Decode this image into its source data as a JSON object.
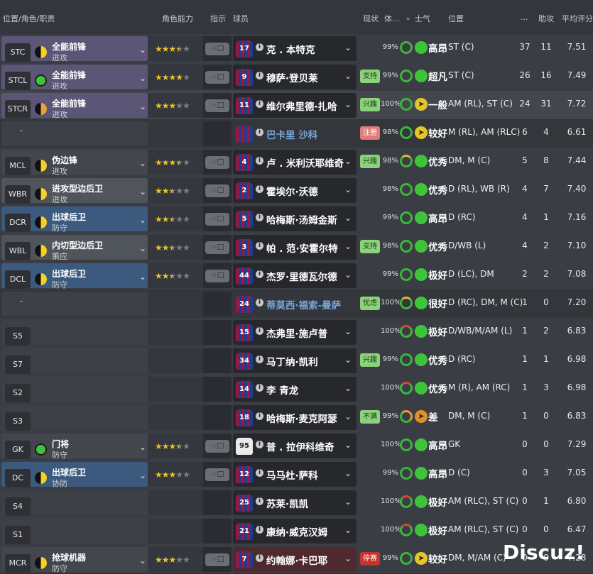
{
  "header": {
    "col_position": "位置/角色/职责",
    "col_ability": "角色能力",
    "col_instruction": "指示",
    "col_player": "球员",
    "col_status": "现状",
    "col_condition": "体...",
    "col_morale": "士气",
    "col_positions": "位置",
    "col_apps": "...",
    "col_assists": "助攻",
    "col_avg_rating": "平均评分"
  },
  "rows": [
    {
      "pos": "STC",
      "role": "全能前锋",
      "duty": "进攻",
      "stars": 3.5,
      "number": "17",
      "name": "克 . 本特克",
      "status": "",
      "cond": "99%",
      "morale": "高昂",
      "positions": "ST (C)",
      "apps": "37",
      "assists": "11",
      "rating": "7.51"
    },
    {
      "pos": "STCL",
      "role": "全能前锋",
      "duty": "进攻",
      "stars": 4,
      "number": "9",
      "name": "穆萨·登贝莱",
      "status": "支持",
      "cond": "99%",
      "morale": "超凡",
      "positions": "ST (C)",
      "apps": "26",
      "assists": "16",
      "rating": "7.49"
    },
    {
      "pos": "STCR",
      "role": "全能前锋",
      "duty": "进攻",
      "stars": 3,
      "number": "11",
      "name": "维尔弗里德·扎哈",
      "status": "兴趣",
      "cond": "100%",
      "morale": "一般",
      "positions": "AM (RL), ST (C)",
      "apps": "24",
      "assists": "31",
      "rating": "7.72"
    },
    {
      "pos": "-",
      "role": "",
      "duty": "",
      "stars": 0,
      "number": "",
      "name": "巴卡里 沙科",
      "status": "注册",
      "cond": "98%",
      "morale": "较好",
      "positions": "M (RL), AM (RLC)",
      "apps": "6",
      "assists": "4",
      "rating": "6.61"
    },
    {
      "pos": "MCL",
      "role": "伪边锋",
      "duty": "进攻",
      "stars": 3.5,
      "number": "4",
      "name": "卢 . 米利沃耶维奇",
      "status": "兴趣",
      "cond": "98%",
      "morale": "优秀",
      "positions": "DM, M (C)",
      "apps": "5",
      "assists": "8",
      "rating": "7.44"
    },
    {
      "pos": "WBR",
      "role": "进攻型边后卫",
      "duty": "进攻",
      "stars": 2.5,
      "number": "2",
      "name": "霍埃尔·沃德",
      "status": "",
      "cond": "98%",
      "morale": "优秀",
      "positions": "D (RL), WB (R)",
      "apps": "4",
      "assists": "7",
      "rating": "7.40"
    },
    {
      "pos": "DCR",
      "role": "出球后卫",
      "duty": "防守",
      "stars": 2.5,
      "number": "5",
      "name": "哈梅斯·汤姆金斯",
      "status": "",
      "cond": "99%",
      "morale": "高昂",
      "positions": "D (RC)",
      "apps": "4",
      "assists": "1",
      "rating": "7.16"
    },
    {
      "pos": "WBL",
      "role": "内切型边后卫",
      "duty": "策应",
      "stars": 2.5,
      "number": "3",
      "name": "帕 . 范·安霍尔特",
      "status": "支持",
      "cond": "98%",
      "morale": "优秀",
      "positions": "D/WB (L)",
      "apps": "4",
      "assists": "2",
      "rating": "7.10"
    },
    {
      "pos": "DCL",
      "role": "出球后卫",
      "duty": "防守",
      "stars": 2.5,
      "number": "44",
      "name": "杰罗·里德瓦尔德",
      "status": "",
      "cond": "99%",
      "morale": "极好",
      "positions": "D (LC), DM",
      "apps": "2",
      "assists": "2",
      "rating": "7.08"
    },
    {
      "pos": "-",
      "role": "",
      "duty": "",
      "stars": 0,
      "number": "24",
      "name": "蒂莫西·福索-曼萨",
      "status": "忧虑",
      "cond": "100%",
      "morale": "很好",
      "positions": "D (RC), DM, M (C)",
      "apps": "1",
      "assists": "0",
      "rating": "7.20"
    },
    {
      "pos": "S5",
      "role": "",
      "duty": "",
      "stars": 0,
      "number": "15",
      "name": "杰弗里·施卢普",
      "status": "",
      "cond": "100%",
      "morale": "极好",
      "positions": "D/WB/M/AM (L)",
      "apps": "1",
      "assists": "2",
      "rating": "6.83"
    },
    {
      "pos": "S7",
      "role": "",
      "duty": "",
      "stars": 0,
      "number": "34",
      "name": "马丁纳·凯利",
      "status": "兴趣",
      "cond": "99%",
      "morale": "优秀",
      "positions": "D (RC)",
      "apps": "1",
      "assists": "1",
      "rating": "6.98"
    },
    {
      "pos": "S2",
      "role": "",
      "duty": "",
      "stars": 0,
      "number": "14",
      "name": "李 青龙",
      "status": "",
      "cond": "100%",
      "morale": "优秀",
      "positions": "M (R), AM (RC)",
      "apps": "1",
      "assists": "3",
      "rating": "6.98"
    },
    {
      "pos": "S3",
      "role": "",
      "duty": "",
      "stars": 0,
      "number": "18",
      "name": "哈梅斯·麦克阿瑟",
      "status": "不满",
      "cond": "99%",
      "morale": "差",
      "positions": "DM, M (C)",
      "apps": "1",
      "assists": "0",
      "rating": "6.83"
    },
    {
      "pos": "GK",
      "role": "门将",
      "duty": "防守",
      "stars": 3.5,
      "number": "95",
      "name": "普 . 拉伊科维奇",
      "status": "",
      "cond": "100%",
      "morale": "高昂",
      "positions": "GK",
      "apps": "0",
      "assists": "0",
      "rating": "7.29"
    },
    {
      "pos": "DC",
      "role": "出球后卫",
      "duty": "协防",
      "stars": 3,
      "number": "12",
      "name": "马马杜·萨科",
      "status": "",
      "cond": "99%",
      "morale": "高昂",
      "positions": "D (C)",
      "apps": "0",
      "assists": "3",
      "rating": "7.05"
    },
    {
      "pos": "S4",
      "role": "",
      "duty": "",
      "stars": 0,
      "number": "25",
      "name": "苏莱·凯凯",
      "status": "",
      "cond": "100%",
      "morale": "极好",
      "positions": "AM (RLC), ST (C)",
      "apps": "0",
      "assists": "1",
      "rating": "6.80"
    },
    {
      "pos": "S1",
      "role": "",
      "duty": "",
      "stars": 0,
      "number": "21",
      "name": "康纳·威克汉姆",
      "status": "",
      "cond": "100%",
      "morale": "极好",
      "positions": "AM (RLC), ST (C)",
      "apps": "0",
      "assists": "0",
      "rating": "6.47"
    },
    {
      "pos": "MCR",
      "role": "抢球机器",
      "duty": "防守",
      "stars": 3,
      "number": "7",
      "name": "约翰娜·卡巴耶",
      "status": "停赛",
      "cond": "99%",
      "morale": "较好",
      "positions": "DM, M/AM (C)",
      "apps": "0",
      "assists": "0",
      "rating": "7.28"
    }
  ],
  "watermark": "Discuz!",
  "colors": {
    "star": "#e8c229",
    "good": "#3ec43a",
    "role_purple": "#5c5676",
    "role_blue": "#3b5a7d"
  }
}
